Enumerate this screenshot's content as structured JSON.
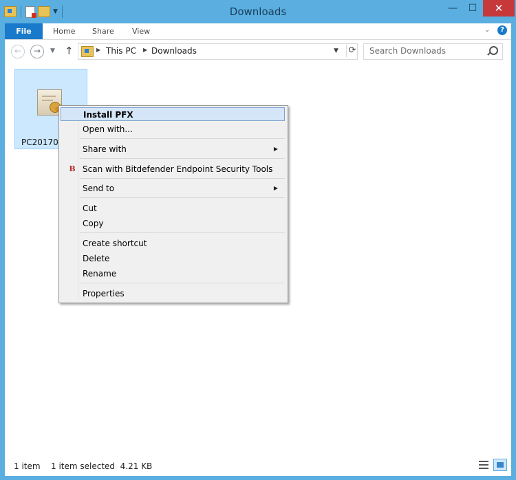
{
  "window": {
    "title": "Downloads"
  },
  "title_controls": {
    "minimize": "—",
    "maximize": "☐",
    "close": "✕"
  },
  "ribbon": {
    "tabs": [
      "File",
      "Home",
      "Share",
      "View"
    ],
    "expand_icon": "chevron-down-icon",
    "help_label": "?"
  },
  "nav": {
    "back_glyph": "←",
    "forward_glyph": "→",
    "up_glyph": "↑",
    "address": {
      "crumbs": [
        "This PC",
        "Downloads"
      ]
    },
    "search_placeholder": "Search Downloads"
  },
  "files": [
    {
      "name": "PC2017031",
      "icon": "certificate-icon",
      "selected": true
    }
  ],
  "context_menu": {
    "items": [
      {
        "label": "Install PFX",
        "default": true,
        "highlighted": true
      },
      {
        "label": "Open with..."
      },
      {
        "label": "Share with",
        "submenu": true
      },
      {
        "label": "Scan with Bitdefender Endpoint Security Tools",
        "icon_glyph": "B"
      },
      {
        "label": "Send to",
        "submenu": true
      },
      {
        "label": "Cut"
      },
      {
        "label": "Copy"
      },
      {
        "label": "Create shortcut"
      },
      {
        "label": "Delete"
      },
      {
        "label": "Rename"
      },
      {
        "label": "Properties"
      }
    ]
  },
  "status": {
    "item_count": "1 item",
    "selection": "1 item selected  4.21 KB"
  },
  "colors": {
    "frame": "#5aaee0",
    "file_tab": "#1979ca",
    "close_button": "#c7383a",
    "selection": "#cce8ff"
  }
}
